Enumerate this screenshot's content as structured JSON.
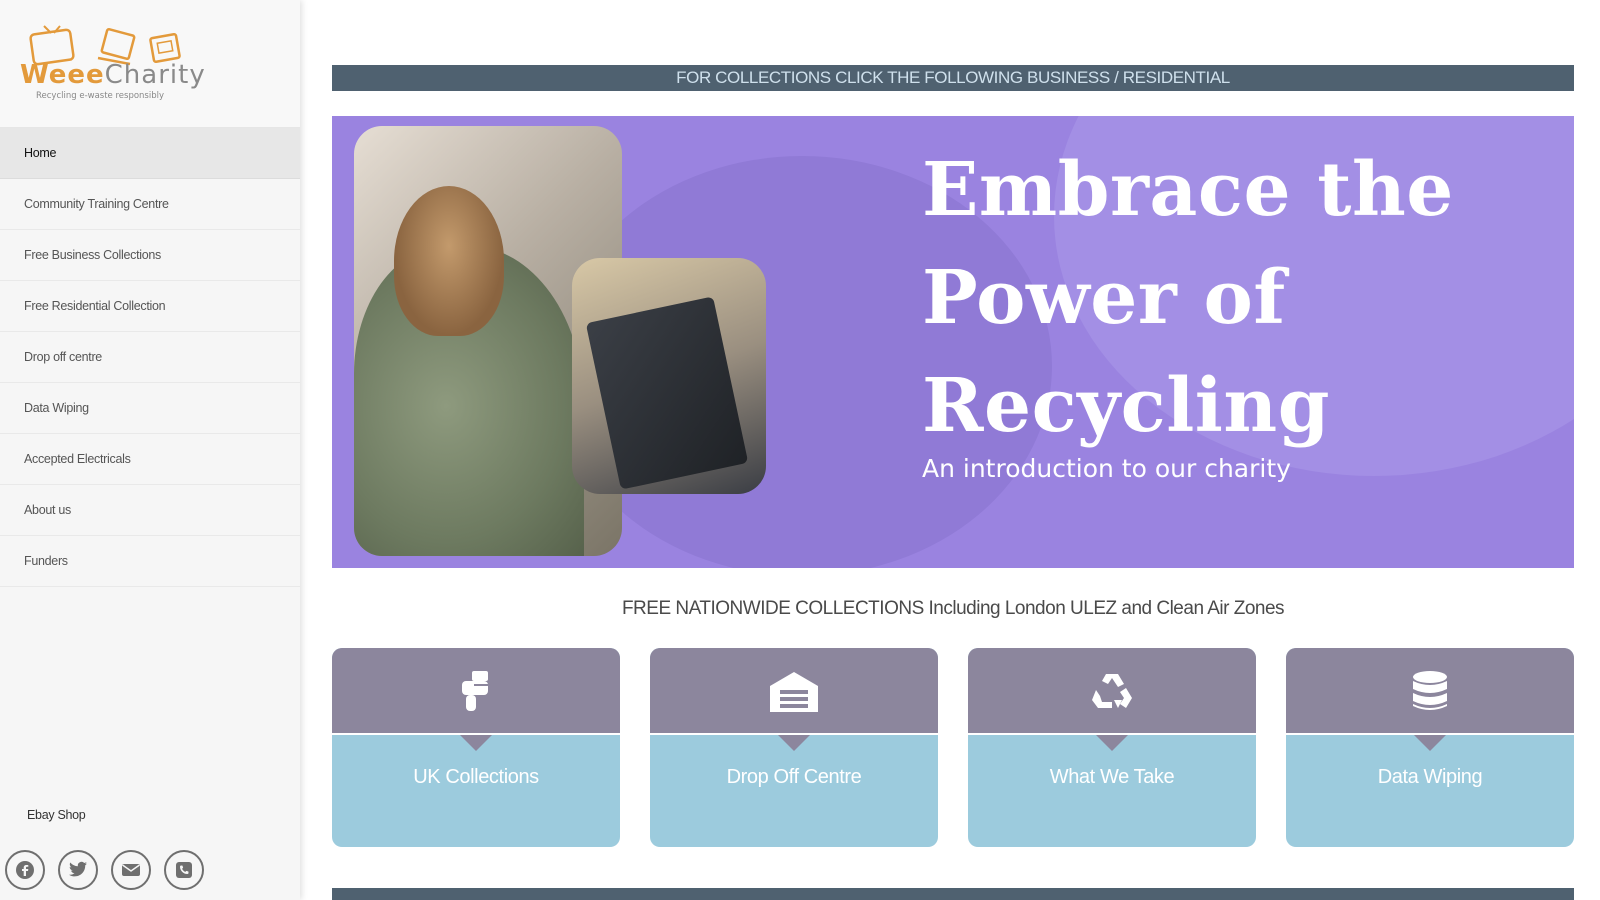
{
  "logo": {
    "name_part1": "Weee",
    "name_part2": "Charity",
    "tagline": "Recycling e-waste responsibly"
  },
  "nav": {
    "items": [
      {
        "label": "Home",
        "active": true
      },
      {
        "label": "Community Training Centre"
      },
      {
        "label": "Free Business Collections"
      },
      {
        "label": "Free Residential Collection"
      },
      {
        "label": "Drop off centre"
      },
      {
        "label": "Data Wiping"
      },
      {
        "label": "Accepted Electricals"
      },
      {
        "label": "About us"
      },
      {
        "label": "Funders"
      }
    ]
  },
  "sidebar": {
    "ebay_label": "Ebay Shop",
    "socials": [
      "facebook-icon",
      "twitter-icon",
      "email-icon",
      "phone-icon"
    ]
  },
  "main": {
    "banner_text": "FOR COLLECTIONS CLICK THE FOLLOWING BUSINESS / RESIDENTIAL",
    "hero": {
      "line1": "Embrace the",
      "line2": "Power of",
      "line3": "Recycling",
      "subtitle": "An introduction to our charity"
    },
    "free_title": "FREE NATIONWIDE COLLECTIONS Including London ULEZ and Clean Air Zones",
    "cards": [
      {
        "label": "UK Collections",
        "icon": "hand-pointing-icon"
      },
      {
        "label": "Drop Off Centre",
        "icon": "warehouse-icon"
      },
      {
        "label": "What We Take",
        "icon": "recycle-icon"
      },
      {
        "label": "Data Wiping",
        "icon": "database-icon"
      }
    ]
  },
  "colors": {
    "banner_bg": "#4f6170",
    "hero_bg": "#9a83e0",
    "card_top": "#8c869d",
    "card_bottom": "#9ccbdd",
    "logo_orange": "#e39a3b"
  }
}
